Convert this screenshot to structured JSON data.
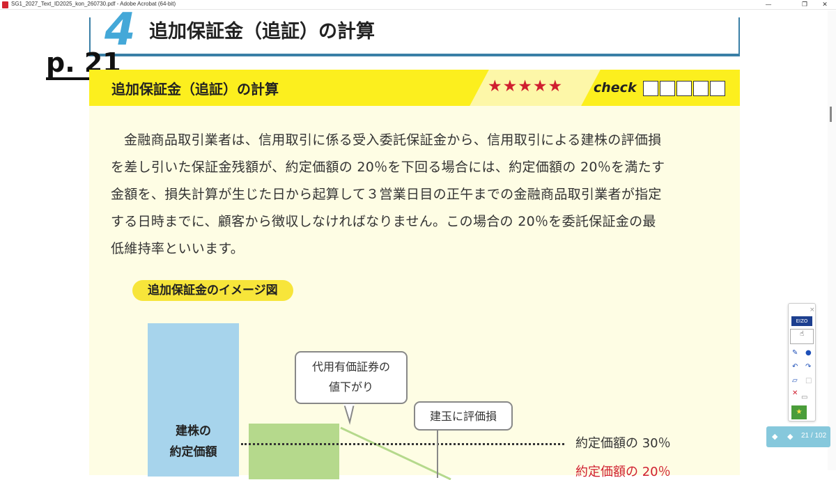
{
  "window": {
    "title": "SG1_2027_Text_ID2025_kon_260730.pdf - Adobe Acrobat (64-bit)",
    "controls": [
      "—",
      "❐",
      "✕"
    ]
  },
  "document": {
    "chapter_number": "4",
    "chapter_title": "追加保証金（追証）の計算",
    "page_label": "p. 21",
    "section": {
      "title": "追加保証金（追証）の計算",
      "rating": "★★★★★",
      "check_label": "check",
      "checkbox_count": 5
    },
    "body_lines": [
      "金融商品取引業者は、信用取引に係る受入委託保証金から、信用取引による建株の評価損",
      "を差し引いた保証金残額が、約定価額の 20％を下回る場合には、約定価額の 20％を満たす",
      "金額を、損失計算が生じた日から起算して３営業日目の正午までの金融商品取引業者が指定",
      "する日時までに、顧客から徴収しなければなりません。この場合の 20％を委託保証金の最",
      "低維持率といいます。"
    ],
    "figure": {
      "label": "追加保証金のイメージ図",
      "stock_label_line1": "建株の",
      "stock_label_line2": "約定価額",
      "callout_a_line1": "代用有価証券の",
      "callout_a_line2": "値下がり",
      "callout_b": "建玉に評価損",
      "line_30_label": "約定価額の 30％",
      "line_20_label": "約定価額の 20％"
    }
  },
  "page_indicator": {
    "text": "21 / 102"
  },
  "colors": {
    "band_yellow": "#fcef1e",
    "panel_bg": "#fefde4",
    "accent_blue": "#44a8d8",
    "star_red": "#d01f2f"
  },
  "icons": [
    "app-pdf-icon",
    "pen-icon",
    "dot-icon",
    "undo-icon",
    "redo-icon",
    "eraser-icon",
    "square-icon",
    "close-x-icon",
    "page-icon",
    "app-launch-icon"
  ]
}
